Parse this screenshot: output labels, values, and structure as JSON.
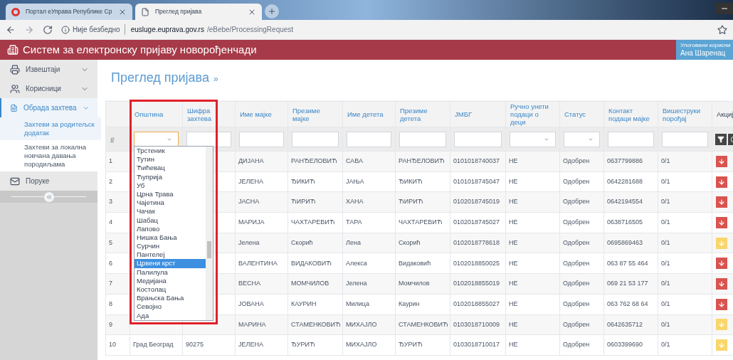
{
  "browser": {
    "tabs": [
      {
        "label": "Портал еУправа Републике Ср",
        "selected": false,
        "kind": "site"
      },
      {
        "label": "Преглед пријава",
        "selected": true,
        "kind": "page"
      }
    ],
    "security": "Није безбедно",
    "url_host": "eusluge.euprava.gov.rs",
    "url_path": "/eBebe/ProcessingRequest"
  },
  "app": {
    "title": "Систем за електронску пријаву новорођенчади",
    "user_label": "Улоговани корисни",
    "user_name": "Ана Шаренац"
  },
  "sidebar": {
    "items": [
      {
        "label": "Извештаји",
        "kind": "reports",
        "expanded": false,
        "selected": false
      },
      {
        "label": "Корисници",
        "kind": "users",
        "expanded": false,
        "selected": false
      },
      {
        "label": "Обрада захтева",
        "kind": "requests",
        "expanded": true,
        "selected": true,
        "children": [
          {
            "label": "Захтеви за родитељск додатак",
            "selected": true
          },
          {
            "label": "Захтеви за локална новчана давања породиљама",
            "selected": false
          }
        ]
      },
      {
        "label": "Поруке",
        "kind": "messages"
      }
    ]
  },
  "page_title": "Преглед пријава",
  "page_title_suffix": "»",
  "table": {
    "columns": [
      "",
      "Општина",
      "Шифра захтева",
      "Име мајке",
      "Презиме мајке",
      "Име детета",
      "Презиме детета",
      "ЈМБГ",
      "Ручно унети подаци о деци",
      "Статус",
      "Контакт подаци мајке",
      "Вишеструки порођај",
      "Акциј"
    ],
    "filters": [
      {
        "kind": "label",
        "text": "#"
      },
      {
        "kind": "select",
        "open": true
      },
      {
        "kind": "text"
      },
      {
        "kind": "text"
      },
      {
        "kind": "text"
      },
      {
        "kind": "text"
      },
      {
        "kind": "text"
      },
      {
        "kind": "text"
      },
      {
        "kind": "select",
        "open": false
      },
      {
        "kind": "select",
        "open": false
      },
      {
        "kind": "text"
      },
      {
        "kind": "text"
      },
      {
        "kind": "actions"
      }
    ],
    "rows": [
      {
        "cells": [
          "1",
          null,
          null,
          "ДИЈАНА",
          "РАНЂЕЛОВИЋ",
          "САВА",
          "РАНЂЕЛОВИЋ",
          "0101018740037",
          "НЕ",
          "Одобрен",
          "0637799886",
          "0/1"
        ],
        "color": "#d9534f"
      },
      {
        "cells": [
          "2",
          null,
          null,
          "ЈЕЛЕНА",
          "ЂИКИЋ",
          "ЈАЊА",
          "ЂИКИЋ",
          "0101018745047",
          "НЕ",
          "Одобрен",
          "0642281688",
          "0/1"
        ],
        "color": "#d9534f"
      },
      {
        "cells": [
          "3",
          null,
          null,
          "ЈАСНА",
          "ЋИРИЋ",
          "ХАНА",
          "ЋИРИЋ",
          "0102018745019",
          "НЕ",
          "Одобрен",
          "0642194554",
          "0/1"
        ],
        "color": "#d9534f"
      },
      {
        "cells": [
          "4",
          null,
          null,
          "МАРИЈА",
          "ЧАХТАРЕВИЋ",
          "ТАРА",
          "ЧАХТАРЕВИЋ",
          "0102018745027",
          "НЕ",
          "Одобрен",
          "0638716505",
          "0/1"
        ],
        "color": "#d9534f"
      },
      {
        "cells": [
          "5",
          null,
          null,
          "Јелена",
          "Скорић",
          "Лена",
          "Скорић",
          "0102018778618",
          "НЕ",
          "Одобрен",
          "0695869463",
          "0/1"
        ],
        "color": "#f9d66b"
      },
      {
        "cells": [
          "6",
          null,
          null,
          "ВАЛЕНТИНА",
          "ВИДАКОВИЋ",
          "Алекса",
          "Видаковић",
          "0102018850025",
          "НЕ",
          "Одобрен",
          "063 87 55 464",
          "0/1"
        ],
        "color": "#d9534f"
      },
      {
        "cells": [
          "7",
          null,
          null,
          "ВЕСНА",
          "МОМЧИЛОВ",
          "Јелена",
          "Момчилов",
          "0102018855019",
          "НЕ",
          "Одобрен",
          "069 21 53 177",
          "0/1"
        ],
        "color": "#d9534f"
      },
      {
        "cells": [
          "8",
          null,
          null,
          "ЈОВАНА",
          "КАУРИН",
          "Милица",
          "Каурин",
          "0102018855027",
          "НЕ",
          "Одобрен",
          "063 762 68 64",
          "0/1"
        ],
        "color": "#d9534f"
      },
      {
        "cells": [
          "9",
          null,
          null,
          "МАРИНА",
          "СТАМЕНКОВИЋ",
          "МИХАЈЛО",
          "СТАМЕНКОВИЋ",
          "0103018710009",
          "НЕ",
          "Одобрен",
          "0642635712",
          "0/1"
        ],
        "color": "#f9d66b"
      },
      {
        "cells": [
          "10",
          "Град Београд",
          "90275",
          "ЈЕЛЕНА",
          "ЂУРИЋ",
          "МИХАЈЛО",
          "ЂУРИЋ",
          "0103018710017",
          "НЕ",
          "Одобрен",
          "0603399690",
          "0/1"
        ],
        "color": "#f9d66b"
      }
    ]
  },
  "dropdown": {
    "options": [
      {
        "label": "Трстеник",
        "selected": false
      },
      {
        "label": "Тутин",
        "selected": false
      },
      {
        "label": "Ћићевац",
        "selected": false
      },
      {
        "label": "Ћуприја",
        "selected": false
      },
      {
        "label": "Уб",
        "selected": false
      },
      {
        "label": "Црна Трава",
        "selected": false
      },
      {
        "label": "Чајетина",
        "selected": false
      },
      {
        "label": "Чачак",
        "selected": false
      },
      {
        "label": "Шабац",
        "selected": false
      },
      {
        "label": "Лапово",
        "selected": false
      },
      {
        "label": "Нишка Бања",
        "selected": false
      },
      {
        "label": "Сурчин",
        "selected": false
      },
      {
        "label": "Пантелеј",
        "selected": false
      },
      {
        "label": "Црвени крст",
        "selected": true
      },
      {
        "label": "Палилула",
        "selected": false
      },
      {
        "label": "Медијана",
        "selected": false
      },
      {
        "label": "Костолац",
        "selected": false
      },
      {
        "label": "Врањска Бања",
        "selected": false
      },
      {
        "label": "Севојно",
        "selected": false
      },
      {
        "label": "Ада",
        "selected": false
      }
    ]
  }
}
